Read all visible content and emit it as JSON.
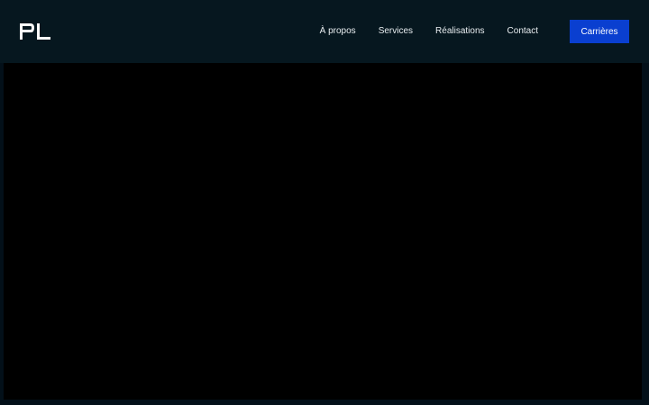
{
  "header": {
    "logo_text": "PL",
    "nav": [
      {
        "label": "À propos"
      },
      {
        "label": "Services"
      },
      {
        "label": "Réalisations"
      },
      {
        "label": "Contact"
      }
    ],
    "cta_label": "Carrières"
  },
  "colors": {
    "header_bg": "#06171f",
    "cta_bg": "#0a3fd0",
    "hero_bg": "#000000",
    "text": "#e9eef1"
  }
}
